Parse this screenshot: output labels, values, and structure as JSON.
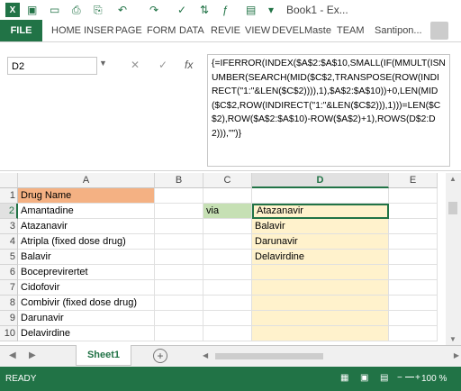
{
  "window": {
    "title": "Book1 - Ex..."
  },
  "qat": {
    "undo": "↶",
    "redo": "↷",
    "save": "💾"
  },
  "ribbon": {
    "file": "FILE",
    "tabs": [
      "HOME",
      "INSER",
      "PAGE",
      "FORM",
      "DATA",
      "REVIE",
      "VIEW",
      "DEVEL",
      "Maste",
      "TEAM"
    ],
    "user": "Santipon..."
  },
  "formula_bar": {
    "name_box": "D2",
    "cancel": "✕",
    "enter": "✓",
    "fx": "fx",
    "formula": "{=IFERROR(INDEX($A$2:$A$10,SMALL(IF(MMULT(ISNUMBER(SEARCH(MID($C$2,TRANSPOSE(ROW(INDIRECT(\"1:\"&LEN($C$2)))),1),$A$2:$A$10))+0,LEN(MID($C$2,ROW(INDIRECT(\"1:\"&LEN($C$2))),1)))=LEN($C$2),ROW($A$2:$A$10)-ROW($A$2)+1),ROWS(D$2:D2))),\"\")}"
  },
  "grid": {
    "columns": [
      "A",
      "B",
      "C",
      "D",
      "E"
    ],
    "rows": [
      "1",
      "2",
      "3",
      "4",
      "5",
      "6",
      "7",
      "8",
      "9",
      "10"
    ],
    "colA": [
      "Drug Name",
      "Amantadine",
      "Atazanavir",
      "Atripla (fixed dose drug)",
      "Balavir",
      "Boceprevirertet",
      "Cidofovir",
      "Combivir (fixed dose drug)",
      "Darunavir",
      "Delavirdine"
    ],
    "colC": [
      "",
      "via",
      "",
      "",
      "",
      "",
      "",
      "",
      "",
      ""
    ],
    "colD": [
      "",
      "Atazanavir",
      "Balavir",
      "Darunavir",
      "Delavirdine",
      "",
      "",
      "",
      "",
      ""
    ],
    "header_fill": "#f4b183",
    "c2_fill": "#c6e0b4",
    "d_fill": "#fff2cc"
  },
  "sheets": {
    "active": "Sheet1",
    "add": "+"
  },
  "status": {
    "ready": "READY",
    "zoom": "100 %"
  }
}
